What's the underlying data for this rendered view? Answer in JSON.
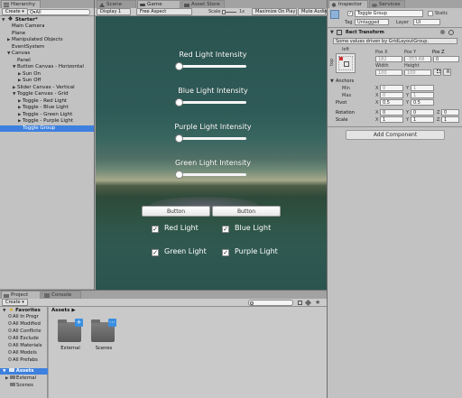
{
  "hierarchy": {
    "tab": "Hierarchy",
    "create_label": "Create ▾",
    "search_placeholder": "Q▾All",
    "scene_name": "Starter*",
    "items": [
      {
        "label": "Main Camera",
        "arrow": ""
      },
      {
        "label": "Plane",
        "arrow": ""
      },
      {
        "label": "Manipulated Objects",
        "arrow": "▶"
      },
      {
        "label": "EventSystem",
        "arrow": ""
      },
      {
        "label": "Canvas",
        "arrow": "▼"
      },
      {
        "label": "Panel",
        "arrow": ""
      },
      {
        "label": "Button Canvas - Horizontal",
        "arrow": "▼"
      },
      {
        "label": "Sun On",
        "arrow": "▶"
      },
      {
        "label": "Sun Off",
        "arrow": "▶"
      },
      {
        "label": "Slider Canvas - Vertical",
        "arrow": "▶"
      },
      {
        "label": "Toggle Canvas - Grid",
        "arrow": "▼"
      },
      {
        "label": "Toggle - Red Light",
        "arrow": "▶"
      },
      {
        "label": "Toggle - Blue Light",
        "arrow": "▶"
      },
      {
        "label": "Toggle - Green Light",
        "arrow": "▶"
      },
      {
        "label": "Toggle - Purple Light",
        "arrow": "▶"
      },
      {
        "label": "Toggle Group",
        "arrow": ""
      }
    ]
  },
  "center_tabs": {
    "scene": "Scene",
    "game": "Game",
    "asset_store": "Asset Store"
  },
  "game_toolbar": {
    "display": "Display 1",
    "aspect": "Free Aspect",
    "scale_label": "Scale",
    "scale_value": "1x",
    "maximize": "Maximize On Play",
    "mute": "Mute Audio"
  },
  "game": {
    "sliders": [
      {
        "label": "Red Light Intensity",
        "value": 0.0
      },
      {
        "label": "Blue Light Intensity",
        "value": 0.0
      },
      {
        "label": "Purple Light Intensity",
        "value": 0.0
      },
      {
        "label": "Green Light Intensity",
        "value": 0.0
      }
    ],
    "buttons": [
      "Button",
      "Button"
    ],
    "toggles": [
      {
        "label": "Red Light",
        "checked": true
      },
      {
        "label": "Blue Light",
        "checked": true
      },
      {
        "label": "Green Light",
        "checked": true
      },
      {
        "label": "Purple Light",
        "checked": true
      }
    ]
  },
  "inspector": {
    "tab": "Inspector",
    "services_tab": "Services",
    "object_name": "Toggle Group",
    "static_label": "Static",
    "tag_label": "Tag",
    "tag_value": "Untagged",
    "layer_label": "Layer",
    "layer_value": "UI",
    "rect_transform": "Rect Transform",
    "driven_note": "Some values driven by GridLayoutGroup.",
    "anchor_preset": "left",
    "anchor_side": "top",
    "pos_x_label": "Pos X",
    "pos_y_label": "Pos Y",
    "pos_z_label": "Pos Z",
    "pos_x": "182",
    "pos_y": "-353.68",
    "pos_z": "0",
    "width_label": "Width",
    "height_label": "Height",
    "width": "100",
    "height": "100",
    "r_button": "R",
    "anchors_label": "Anchors",
    "min_label": "Min",
    "max_label": "Max",
    "min_x": "0",
    "min_y": "1",
    "max_x": "0",
    "max_y": "1",
    "pivot_label": "Pivot",
    "pivot_x": "0.5",
    "pivot_y": "0.5",
    "rotation_label": "Rotation",
    "rot_x": "0",
    "rot_y": "0",
    "rot_z": "0",
    "scale_label": "Scale",
    "scale_x": "1",
    "scale_y": "1",
    "scale_z": "1",
    "x_lbl": "X",
    "y_lbl": "Y",
    "z_lbl": "Z",
    "add_component": "Add Component"
  },
  "project": {
    "tab": "Project",
    "console_tab": "Console",
    "create_label": "Create ▾",
    "favorites_label": "Favorites",
    "favorites": [
      "All In Progr",
      "All Modified",
      "All Conflicte",
      "All Exclude",
      "All Materials",
      "All Models",
      "All Prefabs"
    ],
    "assets_tree_label": "Assets",
    "assets_tree": [
      "External",
      "Scenes"
    ],
    "breadcrumb": "Assets ▶",
    "assets": [
      {
        "label": "External"
      },
      {
        "label": "Scenes"
      }
    ]
  }
}
